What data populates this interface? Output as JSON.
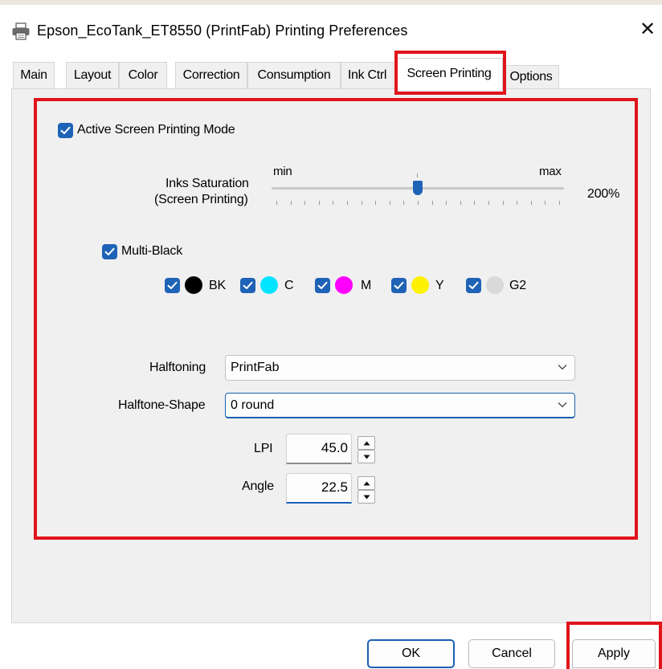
{
  "window": {
    "title": "Epson_EcoTank_ET8550 (PrintFab) Printing Preferences",
    "close_label": "✕"
  },
  "tabs": [
    {
      "label": "Main"
    },
    {
      "label": "Layout"
    },
    {
      "label": "Color"
    },
    {
      "label": "Correction"
    },
    {
      "label": "Consumption"
    },
    {
      "label": "Ink Ctrl"
    },
    {
      "label": "Screen Printing",
      "selected": true
    },
    {
      "label": "Options"
    }
  ],
  "screen_printing": {
    "active_mode_label": "Active Screen Printing Mode",
    "active_mode_checked": true,
    "saturation": {
      "label_line1": "Inks Saturation",
      "label_line2": "(Screen Printing)",
      "min_label": "min",
      "max_label": "max",
      "value_label": "200%",
      "slider_fraction": 0.5
    },
    "multi_black_label": "Multi-Black",
    "multi_black_checked": true,
    "inks": [
      {
        "label": "BK",
        "color": "#000000",
        "checked": true
      },
      {
        "label": "C",
        "color": "#00e5ff",
        "checked": true
      },
      {
        "label": "M",
        "color": "#ff00ff",
        "checked": true
      },
      {
        "label": "Y",
        "color": "#fff200",
        "checked": true
      },
      {
        "label": "G2",
        "color": "#d9d9d9",
        "checked": true
      }
    ],
    "halftoning_label": "Halftoning",
    "halftoning_value": "PrintFab",
    "halftone_shape_label": "Halftone-Shape",
    "halftone_shape_value": "0 round",
    "lpi_label": "LPI",
    "lpi_value": "45.0",
    "angle_label": "Angle",
    "angle_value": "22.5"
  },
  "buttons": {
    "ok": "OK",
    "cancel": "Cancel",
    "apply": "Apply"
  },
  "colors": {
    "accent": "#1f63b6",
    "highlight": "#e0141b"
  }
}
